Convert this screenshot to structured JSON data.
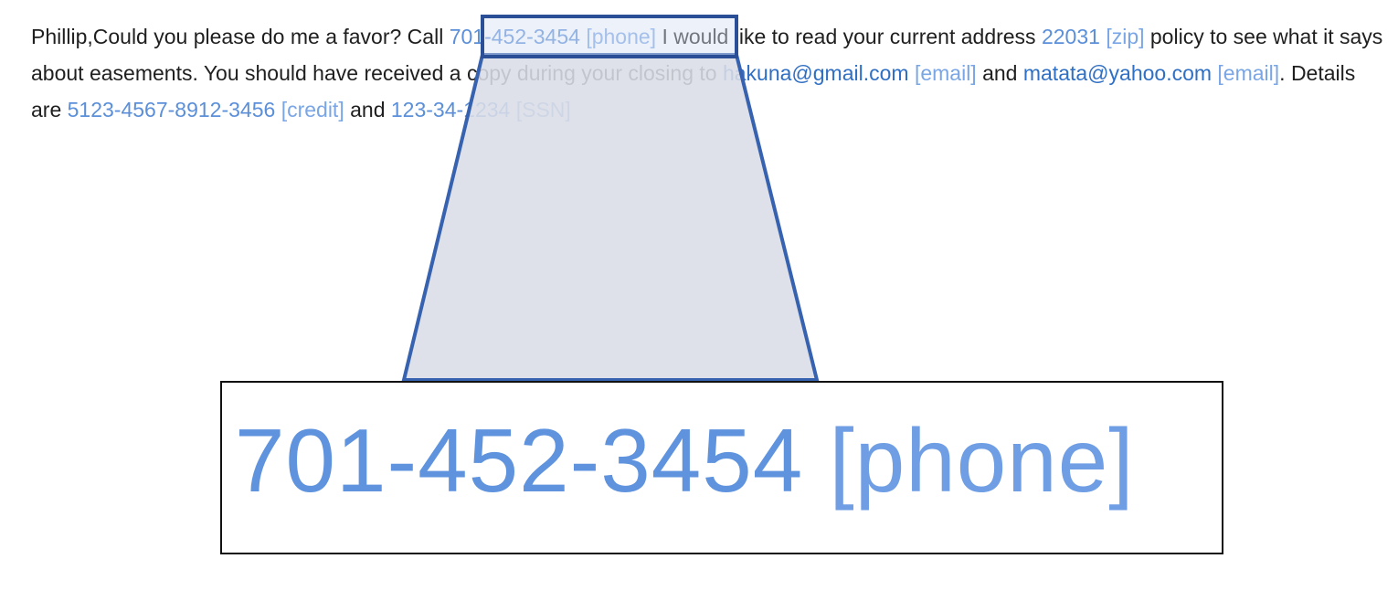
{
  "message": {
    "prefix": "Phillip,Could you please do me a favor? Call ",
    "phone_value": "701-452-3454",
    "phone_tag": "[phone]",
    "mid1": " I would like to read your current address ",
    "zip_value": "22031",
    "zip_tag": "[zip]",
    "mid2": " policy to see what it says about easements. You should have received a copy during your closing to ",
    "email1_value": "hakuna@gmail.com",
    "email1_tag": "[email]",
    "mid3": " and ",
    "email2_value": "matata@yahoo.com",
    "email2_tag": "[email]",
    "mid4": ". Details are ",
    "credit_value": "5123-4567-8912-3456",
    "credit_tag": "[credit]",
    "mid5": " and ",
    "ssn_value": "123-34-1234",
    "ssn_tag": "[SSN]"
  },
  "zoom": {
    "value": "701-452-3454",
    "tag": "[phone]"
  },
  "colors": {
    "entity": "#5b8fd9",
    "tag": "#7aa6e6",
    "highlight_border": "#2a4f96",
    "highlight_fill": "#d9dde6",
    "zoom_border": "#111111"
  },
  "icons": {
    "zoom_connector": "trapezoid-connector-icon"
  }
}
